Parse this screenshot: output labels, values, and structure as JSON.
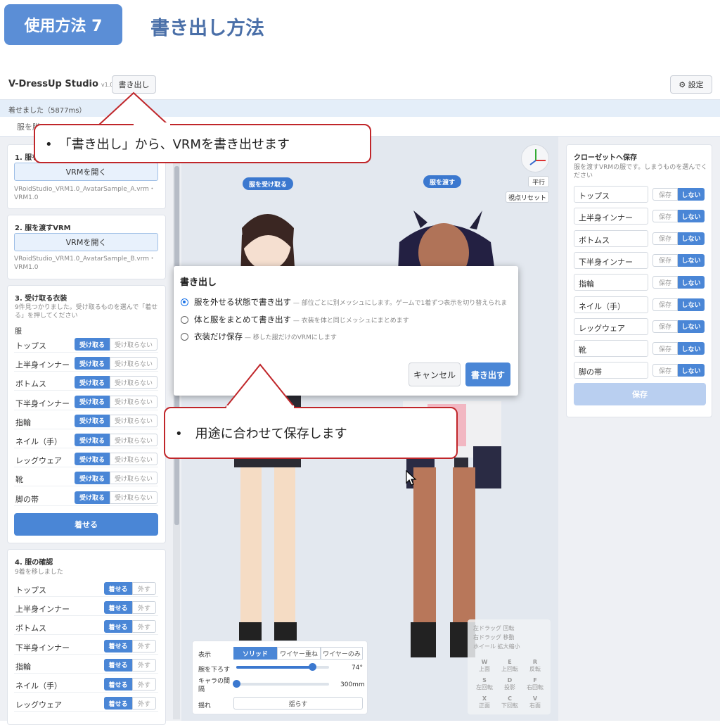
{
  "banner": {
    "step": "使用方法 7",
    "heading": "書き出し方法"
  },
  "app": {
    "name": "V-DressUp Studio",
    "version": "v1.0.0",
    "export_label": "書き出し",
    "settings_label": "⚙ 設定"
  },
  "status": "着せました（5877ms）",
  "tabs": [
    "服を脱"
  ],
  "left": {
    "sec1": {
      "title": "1. 服を受",
      "open_label": "VRMを開く",
      "file": "VRoidStudio_VRM1.0_AvatarSample_A.vrm・VRM1.0"
    },
    "sec2": {
      "title": "2. 服を渡すVRM",
      "open_label": "VRMを開く",
      "file": "VRoidStudio_VRM1.0_AvatarSample_B.vrm・VRM1.0"
    },
    "sec3": {
      "title": "3. 受け取る衣装",
      "note": "9件見つかりました。受け取るものを選んで「着せる」を押してください",
      "group": "服",
      "on_label": "受け取る",
      "off_label": "受け取らない",
      "items": [
        "トップス",
        "上半身インナー",
        "ボトムス",
        "下半身インナー",
        "指輪",
        "ネイル（手）",
        "レッグウェア",
        "靴",
        "脚の帯"
      ],
      "apply_label": "着せる"
    },
    "sec4": {
      "title": "4. 服の確認",
      "note": "9着を移しました",
      "on_label": "着せる",
      "off_label": "外す",
      "items": [
        "トップス",
        "上半身インナー",
        "ボトムス",
        "下半身インナー",
        "指輪",
        "ネイル（手）",
        "レッグウェア"
      ]
    }
  },
  "viewport": {
    "receive_tag": "服を受け取る",
    "give_tag": "服を渡す",
    "parallel_label": "平行",
    "reset_label": "視点リセット",
    "display": {
      "label": "表示",
      "modes": [
        "ソリッド",
        "ワイヤー重ね",
        "ワイヤーのみ"
      ],
      "arm_label": "腕を下ろす",
      "arm_value": "74°",
      "arm_level": 0.82,
      "gap_label": "キャラの間隔",
      "gap_value": "300mm",
      "gap_level": 0.0,
      "sway_label": "揺れ",
      "sway_button": "揺らす"
    },
    "help": {
      "lines": [
        "左ドラッグ 回転",
        "右ドラッグ 移動",
        "ホイール 拡大縮小"
      ],
      "keys": [
        [
          "W",
          "上面"
        ],
        [
          "E",
          "上回転"
        ],
        [
          "R",
          "反転"
        ],
        [
          "S",
          "左回転"
        ],
        [
          "D",
          "投影"
        ],
        [
          "F",
          "右回転"
        ],
        [
          "X",
          "正面"
        ],
        [
          "C",
          "下回転"
        ],
        [
          "V",
          "右面"
        ]
      ]
    }
  },
  "dialog": {
    "title": "書き出し",
    "options": [
      {
        "label": "服を外せる状態で書き出す",
        "desc": " — 部位ごとに別メッシュにします。ゲームで1着ずつ表示を切り替えられま",
        "checked": true
      },
      {
        "label": "体と服をまとめて書き出す",
        "desc": " — 衣装を体と同じメッシュにまとめます",
        "checked": false
      },
      {
        "label": "衣装だけ保存",
        "desc": " — 移した服だけのVRMにします",
        "checked": false
      }
    ],
    "cancel_label": "キャンセル",
    "confirm_label": "書き出す"
  },
  "callouts": {
    "top": "•　「書き出し」から、VRMを書き出せます",
    "bottom": "•　用途に合わせて保存します"
  },
  "right": {
    "title": "クローゼットへ保存",
    "note": "服を渡すVRMの服です。しまうものを選んでください",
    "save_label": "保存",
    "nosave_label": "しない",
    "items": [
      "トップス",
      "上半身インナー",
      "ボトムス",
      "下半身インナー",
      "指輪",
      "ネイル（手）",
      "レッグウェア",
      "靴",
      "脚の帯"
    ],
    "submit_label": "保存"
  },
  "colors": {
    "accent": "#4a86d6",
    "callout_border": "#c0262a",
    "banner": "#5b8ed6"
  }
}
